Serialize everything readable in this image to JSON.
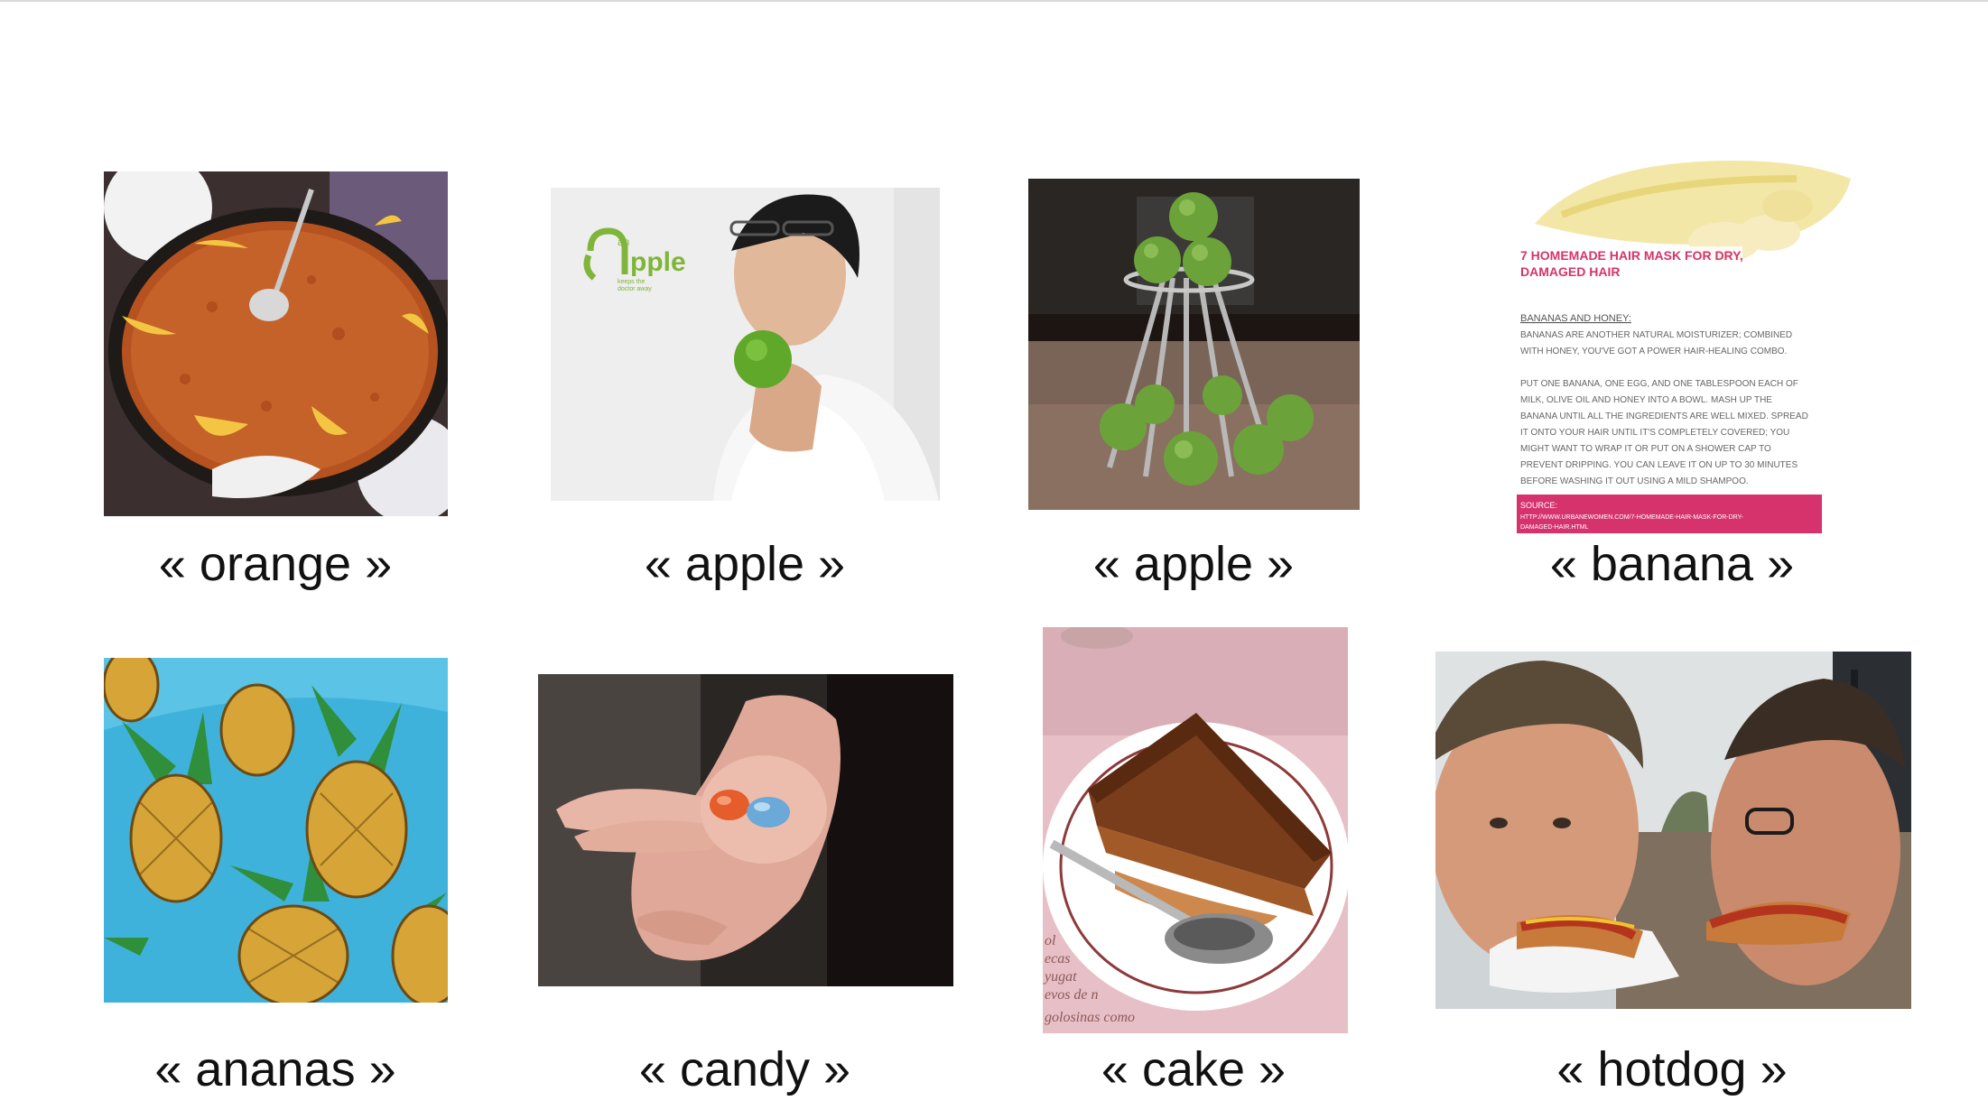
{
  "items": [
    {
      "label": "« orange »"
    },
    {
      "label": "« apple »"
    },
    {
      "label": "« apple »"
    },
    {
      "label": "« banana »"
    },
    {
      "label": "« ananas »"
    },
    {
      "label": "« candy »"
    },
    {
      "label": "« cake »"
    },
    {
      "label": "« hotdog »"
    }
  ],
  "apple_logo": {
    "word": "pple",
    "small": "an",
    "tagline_1": "keeps the",
    "tagline_2": "doctor away"
  },
  "banana_card": {
    "title_1": "7 HOMEMADE HAIR MASK FOR DRY,",
    "title_2": "DAMAGED HAIR",
    "heading": "BANANAS AND HONEY:",
    "lines": [
      "BANANAS ARE ANOTHER NATURAL MOISTURIZER; COMBINED",
      "WITH HONEY, YOU'VE GOT A POWER HAIR-HEALING COMBO.",
      "",
      "PUT ONE BANANA, ONE EGG, AND ONE TABLESPOON EACH OF",
      "MILK, OLIVE OIL AND HONEY INTO A BOWL. MASH UP THE",
      "BANANA UNTIL ALL THE INGREDIENTS ARE WELL MIXED. SPREAD",
      "IT ONTO YOUR HAIR UNTIL IT'S COMPLETELY COVERED; YOU",
      "MIGHT WANT TO WRAP IT OR PUT ON A SHOWER CAP TO",
      "PREVENT DRIPPING. YOU CAN LEAVE IT ON UP TO 30 MINUTES",
      "BEFORE WASHING IT OUT USING A MILD SHAMPOO."
    ],
    "source_label": "SOURCE:",
    "source_url_1": "HTTP://WWW.URBANEWOMEN.COM/7-HOMEMADE-HAIR-MASK-FOR-DRY-",
    "source_url_2": "DAMAGED-HAIR.HTML"
  },
  "cake_tablecloth": {
    "line_1": "ol",
    "line_2": "ecas",
    "line_3": "yugat",
    "line_4": "evos de n",
    "line_5": "golosinas como"
  },
  "colors": {
    "background": "#ffffff",
    "caption_text": "#111111",
    "apple_green": "#7fb53a",
    "banana_pink": "#d6336c",
    "pineapple_blue": "#3fb2dc"
  }
}
